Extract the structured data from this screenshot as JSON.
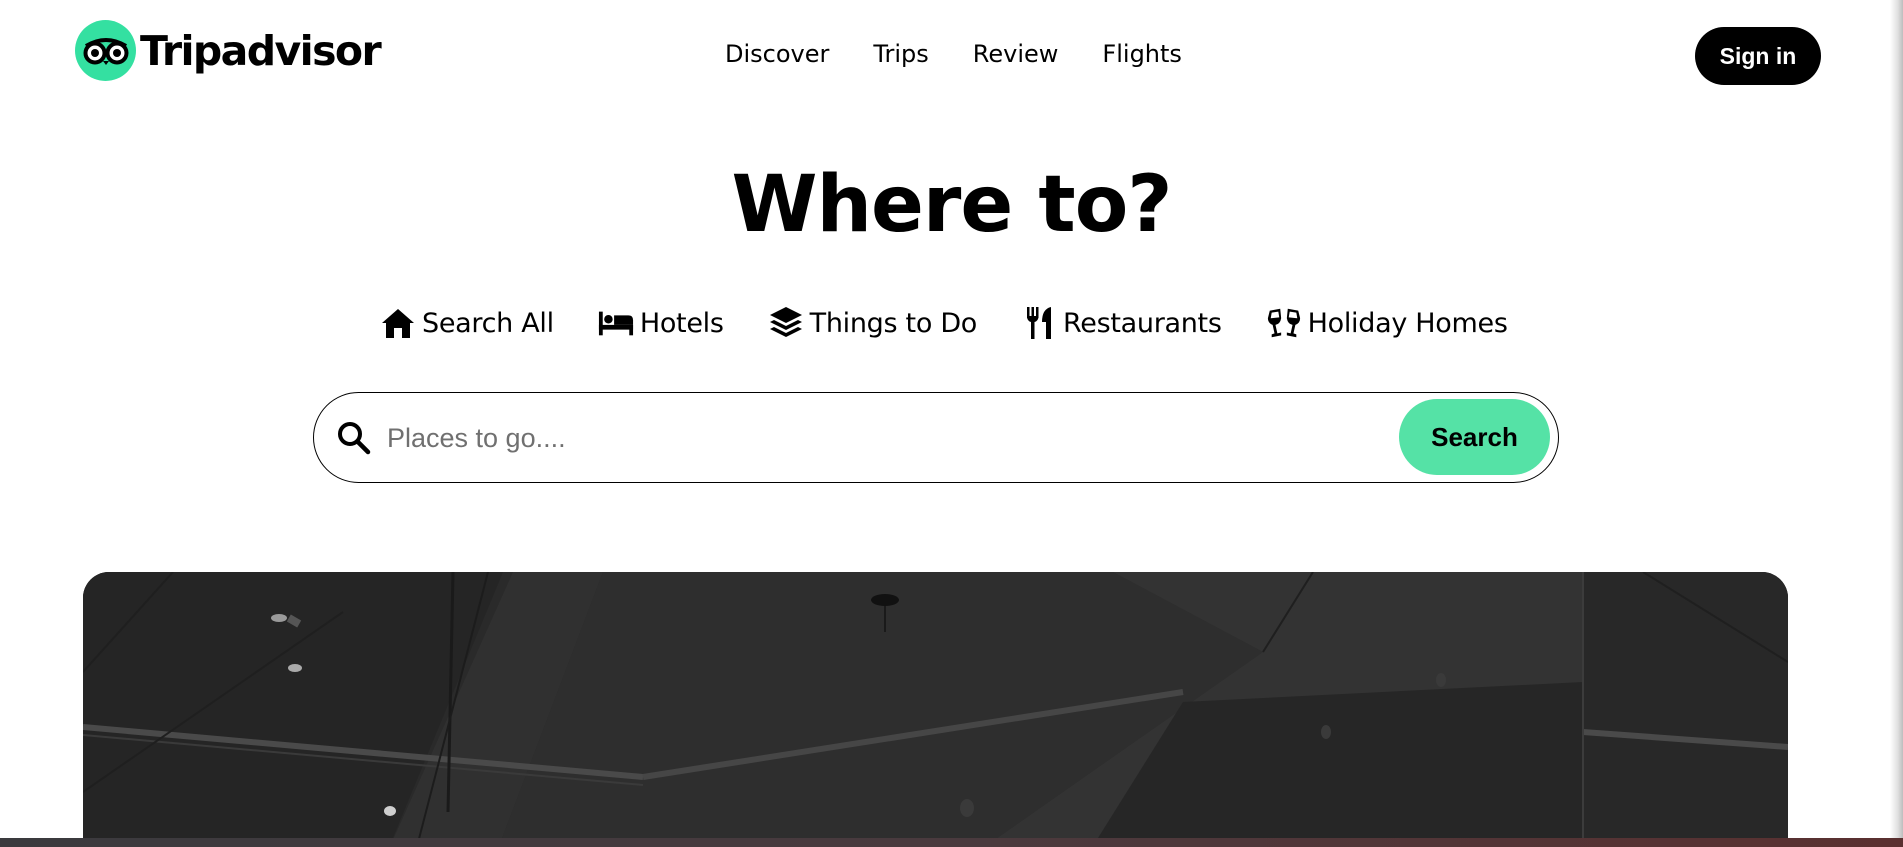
{
  "brand": {
    "name": "Tripadvisor",
    "color": "#34e0a1"
  },
  "nav": {
    "items": [
      {
        "label": "Discover"
      },
      {
        "label": "Trips"
      },
      {
        "label": "Review"
      },
      {
        "label": "Flights"
      }
    ]
  },
  "header": {
    "signin_label": "Sign in"
  },
  "hero": {
    "title": "Where to?"
  },
  "categories": [
    {
      "label": "Search All",
      "icon": "home-icon"
    },
    {
      "label": "Hotels",
      "icon": "bed-icon"
    },
    {
      "label": "Things to Do",
      "icon": "layers-icon"
    },
    {
      "label": "Restaurants",
      "icon": "utensils-icon"
    },
    {
      "label": "Holiday Homes",
      "icon": "glasses-cheers-icon"
    }
  ],
  "search": {
    "placeholder": "Places to go....",
    "value": "",
    "button_label": "Search",
    "button_color": "#55e2a6"
  }
}
